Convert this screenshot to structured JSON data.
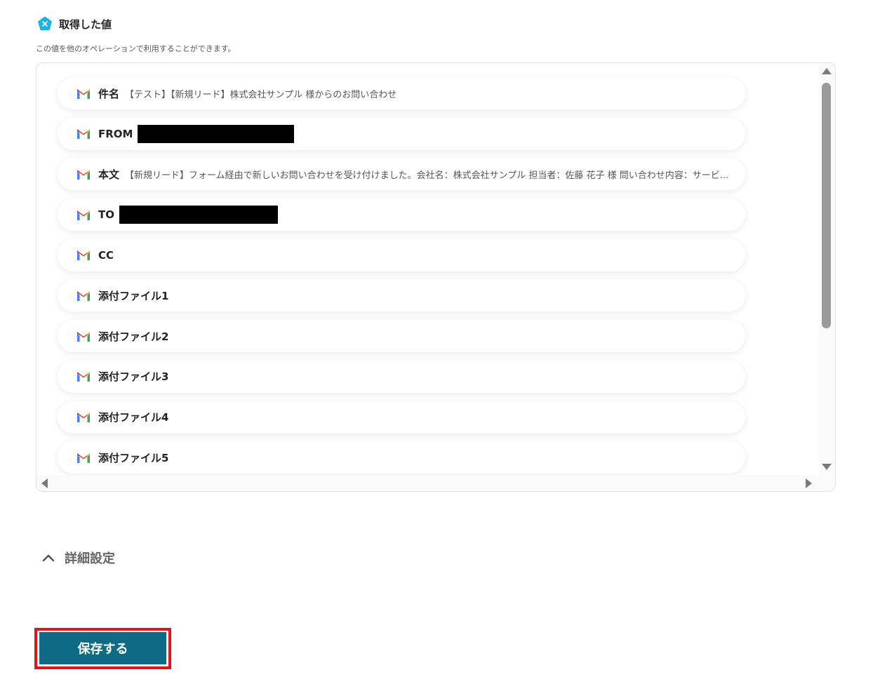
{
  "section": {
    "title": "取得した値",
    "description": "この値を他のオペレーションで利用することができます。"
  },
  "values": [
    {
      "label": "件名",
      "value": "【テスト】【新規リード】株式会社サンプル 様からのお問い合わせ",
      "redacted": false
    },
    {
      "label": "FROM",
      "value": "",
      "redacted": true
    },
    {
      "label": "本文",
      "value": "【新規リード】フォーム経由で新しいお問い合わせを受け付けました。会社名：株式会社サンプル 担当者：佐藤 花子 様 問い合わせ内容：サービ...",
      "redacted": false
    },
    {
      "label": "TO",
      "value": "",
      "redacted": true
    },
    {
      "label": "CC",
      "value": "",
      "redacted": false
    },
    {
      "label": "添付ファイル1",
      "value": "",
      "redacted": false
    },
    {
      "label": "添付ファイル2",
      "value": "",
      "redacted": false
    },
    {
      "label": "添付ファイル3",
      "value": "",
      "redacted": false
    },
    {
      "label": "添付ファイル4",
      "value": "",
      "redacted": false
    },
    {
      "label": "添付ファイル5",
      "value": "",
      "redacted": false
    }
  ],
  "advanced": {
    "label": "詳細設定"
  },
  "save": {
    "label": "保存する"
  },
  "colors": {
    "accent": "#0f6b85",
    "highlight": "#e0161c",
    "badge": "#1ab3e6"
  },
  "icons": {
    "badge": "x-badge-icon",
    "value": "gmail-icon",
    "toggle": "chevron-up-icon"
  }
}
